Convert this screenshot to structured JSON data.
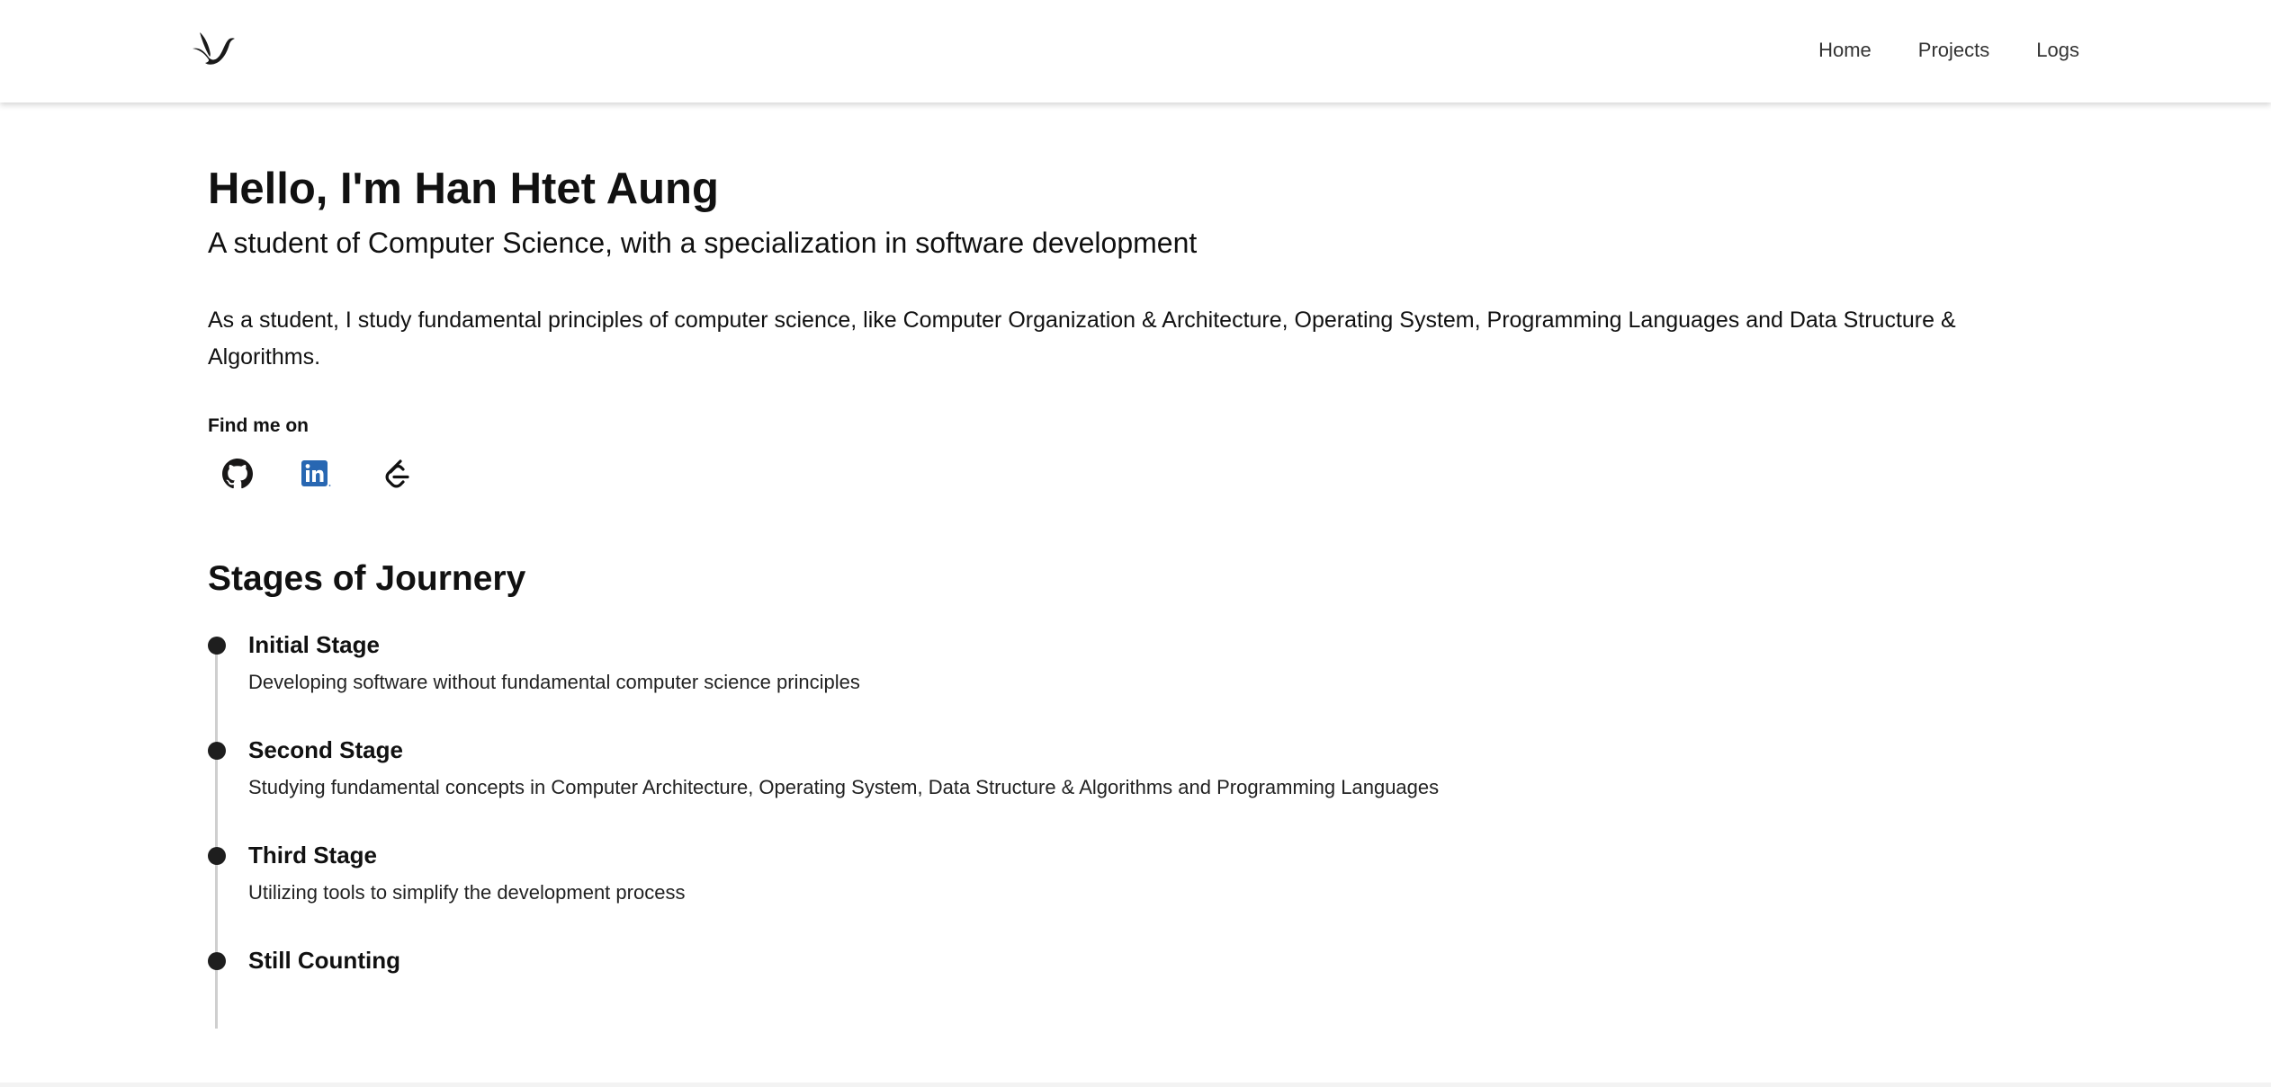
{
  "nav": {
    "logo": "bird-logo-icon",
    "links": [
      {
        "label": "Home"
      },
      {
        "label": "Projects"
      },
      {
        "label": "Logs"
      }
    ]
  },
  "hero": {
    "title": "Hello, I'm Han Htet Aung",
    "subtitle": "A student of Computer Science, with a specialization in software development",
    "description": "As a student, I study fundamental principles of computer science, like Computer Organization & Architecture, Operating System, Programming Languages and Data Structure & Algorithms."
  },
  "socials": {
    "label": "Find me on",
    "items": [
      {
        "icon": "github-icon",
        "color": "#181717"
      },
      {
        "icon": "linkedin-icon",
        "color": "#2867b2"
      },
      {
        "icon": "leetcode-icon",
        "color": "#111111"
      }
    ]
  },
  "journey": {
    "title": "Stages of Journery",
    "line_color": "#cfcfcf",
    "dot_color": "#1e1e1e",
    "stages": [
      {
        "title": "Initial Stage",
        "description": "Developing software without fundamental computer science principles"
      },
      {
        "title": "Second Stage",
        "description": "Studying fundamental concepts in Computer Architecture, Operating System, Data Structure & Algorithms and Programming Languages"
      },
      {
        "title": "Third Stage",
        "description": "Utilizing tools to simplify the development process"
      },
      {
        "title": "Still Counting",
        "description": ""
      }
    ]
  }
}
